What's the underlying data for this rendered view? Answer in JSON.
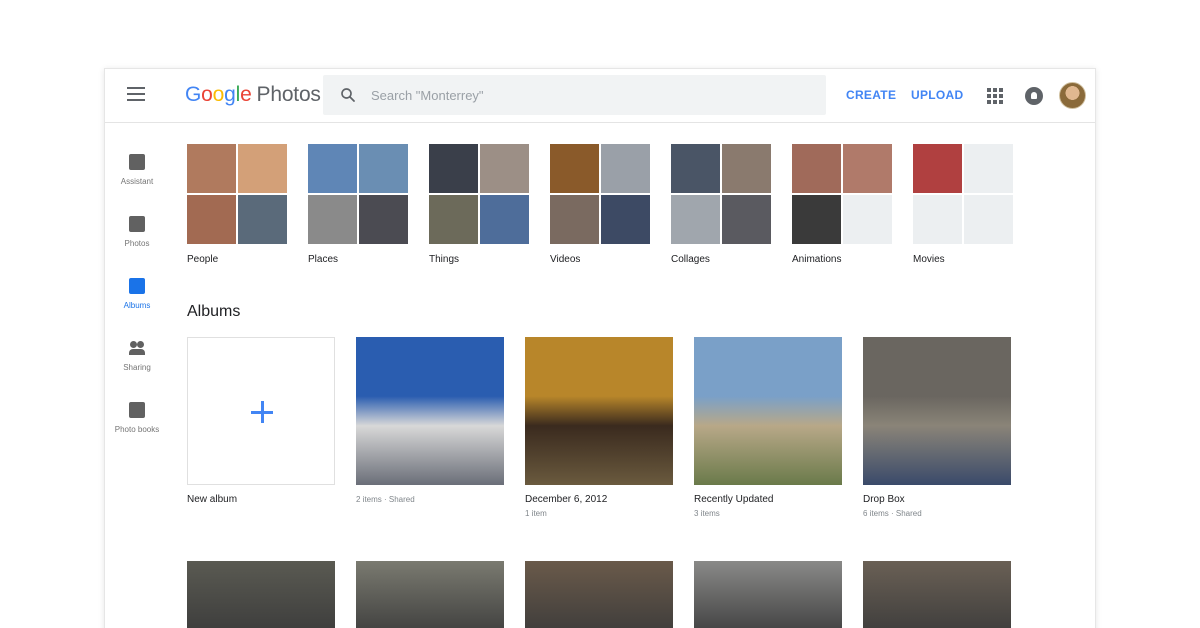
{
  "app": {
    "logo_letters": [
      "G",
      "o",
      "o",
      "g",
      "l",
      "e"
    ],
    "logo_product": "Photos"
  },
  "header": {
    "search_placeholder": "Search \"Monterrey\"",
    "create_label": "CREATE",
    "upload_label": "UPLOAD",
    "icons": [
      "menu-icon",
      "search-icon",
      "apps-grid-icon",
      "notifications-icon",
      "account-avatar"
    ]
  },
  "sidebar": {
    "items": [
      {
        "label": "Assistant",
        "icon": "assistant-icon",
        "active": false
      },
      {
        "label": "Photos",
        "icon": "photo-icon",
        "active": false
      },
      {
        "label": "Albums",
        "icon": "album-icon",
        "active": true
      },
      {
        "label": "Sharing",
        "icon": "people-icon",
        "active": false
      },
      {
        "label": "Photo books",
        "icon": "book-icon",
        "active": false
      }
    ]
  },
  "categories": [
    {
      "label": "People",
      "tiles": [
        "#b07a5e",
        "#d3a078",
        "#a26a52",
        "#5a6a7a"
      ]
    },
    {
      "label": "Places",
      "tiles": [
        "#5f86b6",
        "#6a8eb3",
        "#8a8a8a",
        "#4b4b52"
      ]
    },
    {
      "label": "Things",
      "tiles": [
        "#3a3f4a",
        "#9c8f86",
        "#6c6a5a",
        "#4e6d9a"
      ]
    },
    {
      "label": "Videos",
      "tiles": [
        "#8a5a2a",
        "#9aa0a8",
        "#7a6a60",
        "#3d4a64"
      ]
    },
    {
      "label": "Collages",
      "tiles": [
        "#4a5566",
        "#8a7a6e",
        "#a0a6ad",
        "#5a5a60"
      ]
    },
    {
      "label": "Animations",
      "tiles": [
        "#a06a5a",
        "#b07a6a",
        "#3a3a3a",
        "#eceff1"
      ]
    },
    {
      "label": "Movies",
      "tiles": [
        "#b04040",
        "#eceff1",
        "#eceff1",
        "#eceff1"
      ]
    }
  ],
  "albums_section": {
    "title": "Albums",
    "albums": [
      {
        "title": "New album",
        "meta": "",
        "type": "new"
      },
      {
        "title": "",
        "meta": "2 items · Shared",
        "colors": [
          "#2a5db0",
          "#d8d8d8",
          "#6a6e78"
        ]
      },
      {
        "title": "December 6, 2012",
        "meta": "1 item",
        "colors": [
          "#b8862a",
          "#3a2a1e",
          "#6a5a3e"
        ]
      },
      {
        "title": "Recently Updated",
        "meta": "3 items",
        "colors": [
          "#7aa0c8",
          "#b8a888",
          "#6a7a4a"
        ]
      },
      {
        "title": "Drop Box",
        "meta": "6 items · Shared",
        "colors": [
          "#6a6660",
          "#8a8478",
          "#3a4a6a"
        ]
      }
    ],
    "second_row_colors": [
      "#5a5a52",
      "#7a7a70",
      "#6a5a4a",
      "#8a8a88",
      "#6a6055"
    ]
  }
}
